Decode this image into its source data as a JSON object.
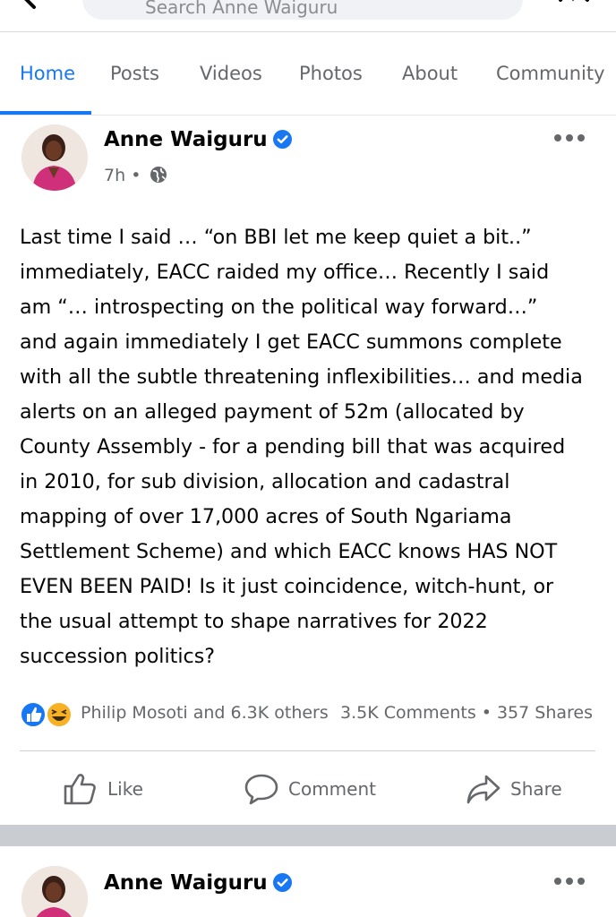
{
  "search": {
    "placeholder": "Search Anne Waiguru"
  },
  "tabs": [
    {
      "label": "Home",
      "active": true
    },
    {
      "label": "Posts",
      "active": false
    },
    {
      "label": "Videos",
      "active": false
    },
    {
      "label": "Photos",
      "active": false
    },
    {
      "label": "About",
      "active": false
    },
    {
      "label": "Community",
      "active": false
    }
  ],
  "post": {
    "author": "Anne Waiguru",
    "time": "7h",
    "separator": "•",
    "text_lines": [
      "Last time I said … “on BBI let me keep quiet a bit..”",
      "immediately, EACC raided my office…  Recently I said",
      "am “… introspecting on the political way forward…”",
      "and again immediately I get EACC summons complete",
      "with all the subtle threatening inflexibilities… and media",
      "alerts on an alleged payment of 52m (allocated by",
      "County Assembly - for a pending bill that was acquired",
      "in 2010, for sub division, allocation and cadastral",
      "mapping of over 17,000 acres of South Ngariama",
      "Settlement Scheme) and which EACC knows HAS NOT",
      "EVEN BEEN PAID!  Is it just coincidence, witch-hunt, or",
      "the usual attempt to shape narratives for 2022",
      "succession politics?"
    ],
    "reactions_names": "Philip Mosoti and 6.3K others",
    "comments": "3.5K Comments",
    "dot": "•",
    "shares": "357 Shares",
    "actions": {
      "like": "Like",
      "comment": "Comment",
      "share": "Share"
    }
  },
  "post2": {
    "author": "Anne Waiguru"
  },
  "colors": {
    "accent": "#1877f2",
    "muted": "#65676b",
    "separator": "#c9ccd1",
    "haha": "#f7b125"
  },
  "icons": [
    "back-arrow-icon",
    "search-icon",
    "messenger-icon",
    "verified-badge-icon",
    "globe-icon",
    "more-options-icon",
    "like-reaction-icon",
    "haha-reaction-icon",
    "like-icon",
    "comment-icon",
    "share-icon"
  ]
}
